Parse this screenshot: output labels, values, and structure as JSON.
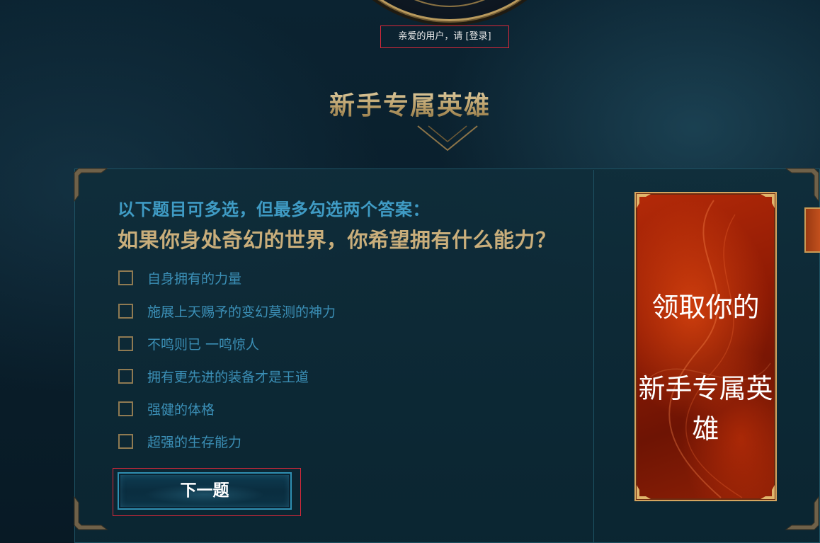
{
  "header": {
    "greeting": "亲爱的用户，请 ",
    "login_link": "[登录]"
  },
  "section": {
    "title": "新手专属英雄"
  },
  "quiz": {
    "hint": "以下题目可多选，但最多勾选两个答案：",
    "question": "如果你身处奇幻的世界，你希望拥有什么能力？",
    "options": [
      {
        "label": "自身拥有的力量",
        "checked": false
      },
      {
        "label": "施展上天赐予的变幻莫测的神力",
        "checked": false
      },
      {
        "label": "不鸣则已 一鸣惊人",
        "checked": false
      },
      {
        "label": "拥有更先进的装备才是王道",
        "checked": false
      },
      {
        "label": "强健的体格",
        "checked": false
      },
      {
        "label": "超强的生存能力",
        "checked": false
      }
    ],
    "next_button": "下一题"
  },
  "promo": {
    "line1": "领取你的",
    "line2": "新手专属英雄"
  },
  "colors": {
    "background": "#0a1f2c",
    "gold": "#c9ae7b",
    "blue_text": "#3b8fb6",
    "promo_red": "#9e2206",
    "highlight_border": "#d8283a"
  }
}
